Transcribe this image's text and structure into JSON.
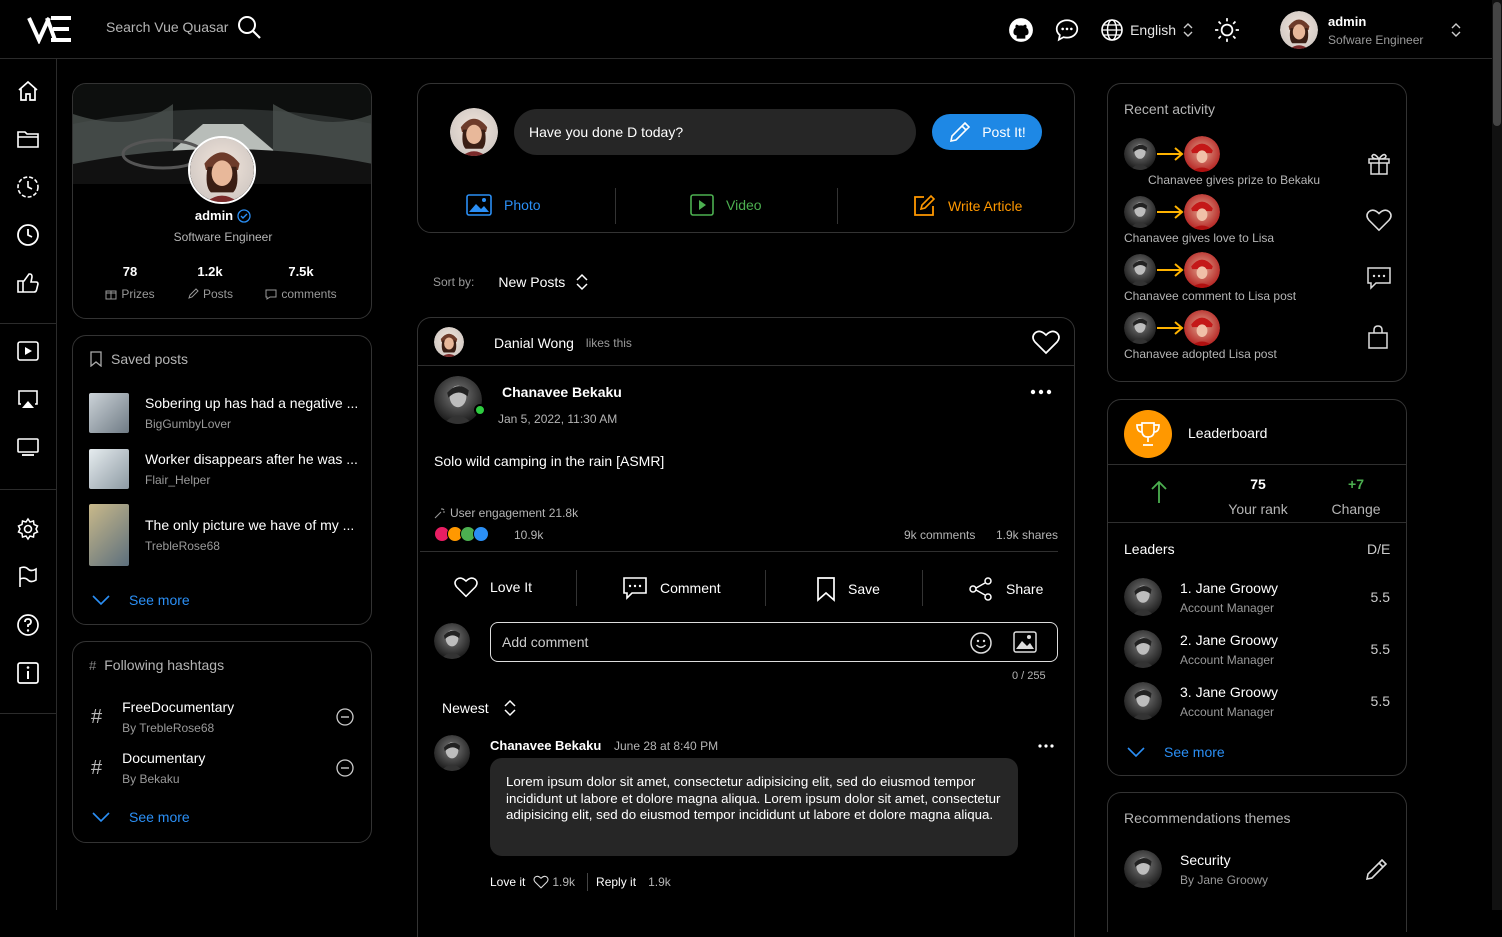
{
  "header": {
    "logo_text": "VE",
    "search_placeholder": "Search Vue Quasar",
    "language": "English",
    "user": {
      "name": "admin",
      "role": "Sofware Engineer"
    }
  },
  "profile": {
    "name": "admin",
    "role": "Software Engineer",
    "stats": [
      {
        "value": "78",
        "label": "Prizes"
      },
      {
        "value": "1.2k",
        "label": "Posts"
      },
      {
        "value": "7.5k",
        "label": "comments"
      }
    ]
  },
  "saved_posts": {
    "title": "Saved posts",
    "items": [
      {
        "title": "Sobering up has had a negative ...",
        "author": "BigGumbyLover"
      },
      {
        "title": "Worker disappears after he was ...",
        "author": "Flair_Helper"
      },
      {
        "title": "The only picture we have of my ...",
        "author": "TrebleRose68"
      }
    ],
    "see_more": "See more"
  },
  "hashtags": {
    "title": "Following hashtags",
    "items": [
      {
        "name": "FreeDocumentary",
        "by": "By TrebleRose68"
      },
      {
        "name": "Documentary",
        "by": "By Bekaku"
      }
    ],
    "see_more": "See more"
  },
  "composer": {
    "placeholder": "Have you done D today?",
    "post_button": "Post It!",
    "actions": [
      {
        "label": "Photo",
        "color": "#2b8ff5"
      },
      {
        "label": "Video",
        "color": "#4caf50"
      },
      {
        "label": "Write Article",
        "color": "#ff9800"
      }
    ]
  },
  "sort": {
    "label": "Sort by:",
    "value": "New Posts"
  },
  "post": {
    "liker": "Danial Wong",
    "liker_action": "likes this",
    "author": "Chanavee Bekaku",
    "date": "Jan 5, 2022, 11:30 AM",
    "content": "Solo wild camping in the rain [ASMR]",
    "engagement": "User engagement 21.8k",
    "reaction_count": "10.9k",
    "comments": "9k comments",
    "shares": "1.9k shares",
    "actions": {
      "love": "Love It",
      "comment": "Comment",
      "save": "Save",
      "share": "Share"
    },
    "add_comment_placeholder": "Add comment",
    "char_counter": "0 / 255",
    "comments_sort": "Newest",
    "comment": {
      "author": "Chanavee Bekaku",
      "time": "June 28 at 8:40 PM",
      "text": "Lorem ipsum dolor sit amet, consectetur adipisicing elit, sed do eiusmod tempor incididunt ut labore et dolore magna aliqua. Lorem ipsum dolor sit amet, consectetur adipisicing elit, sed do eiusmod tempor incididunt ut labore et dolore magna aliqua.",
      "love_label": "Love it",
      "love_count": "1.9k",
      "reply_label": "Reply it",
      "reply_count": "1.9k"
    }
  },
  "activity": {
    "title": "Recent activity",
    "items": [
      {
        "text": "Chanavee gives prize to Bekaku",
        "icon": "gift-icon"
      },
      {
        "text": "Chanavee gives love to Lisa",
        "icon": "heart-icon"
      },
      {
        "text": "Chanavee comment to Lisa post",
        "icon": "comment-icon"
      },
      {
        "text": "Chanavee adopted Lisa post",
        "icon": "bag-icon"
      }
    ]
  },
  "leaderboard": {
    "title": "Leaderboard",
    "rank": "75",
    "rank_label": "Your rank",
    "change": "+7",
    "change_label": "Change",
    "leaders_label": "Leaders",
    "de_label": "D/E",
    "leaders": [
      {
        "name": "1. Jane Groowy",
        "role": "Account Manager",
        "value": "5.5"
      },
      {
        "name": "2. Jane Groowy",
        "role": "Account Manager",
        "value": "5.5"
      },
      {
        "name": "3. Jane Groowy",
        "role": "Account Manager",
        "value": "5.5"
      }
    ],
    "see_more": "See more"
  },
  "recommendations": {
    "title": "Recommendations themes",
    "items": [
      {
        "name": "Security",
        "by": "By Jane Groowy"
      }
    ]
  },
  "colors": {
    "accent": "#2b8ff5",
    "success": "#4caf50",
    "warning": "#ff9800",
    "online": "#2ecc40"
  }
}
